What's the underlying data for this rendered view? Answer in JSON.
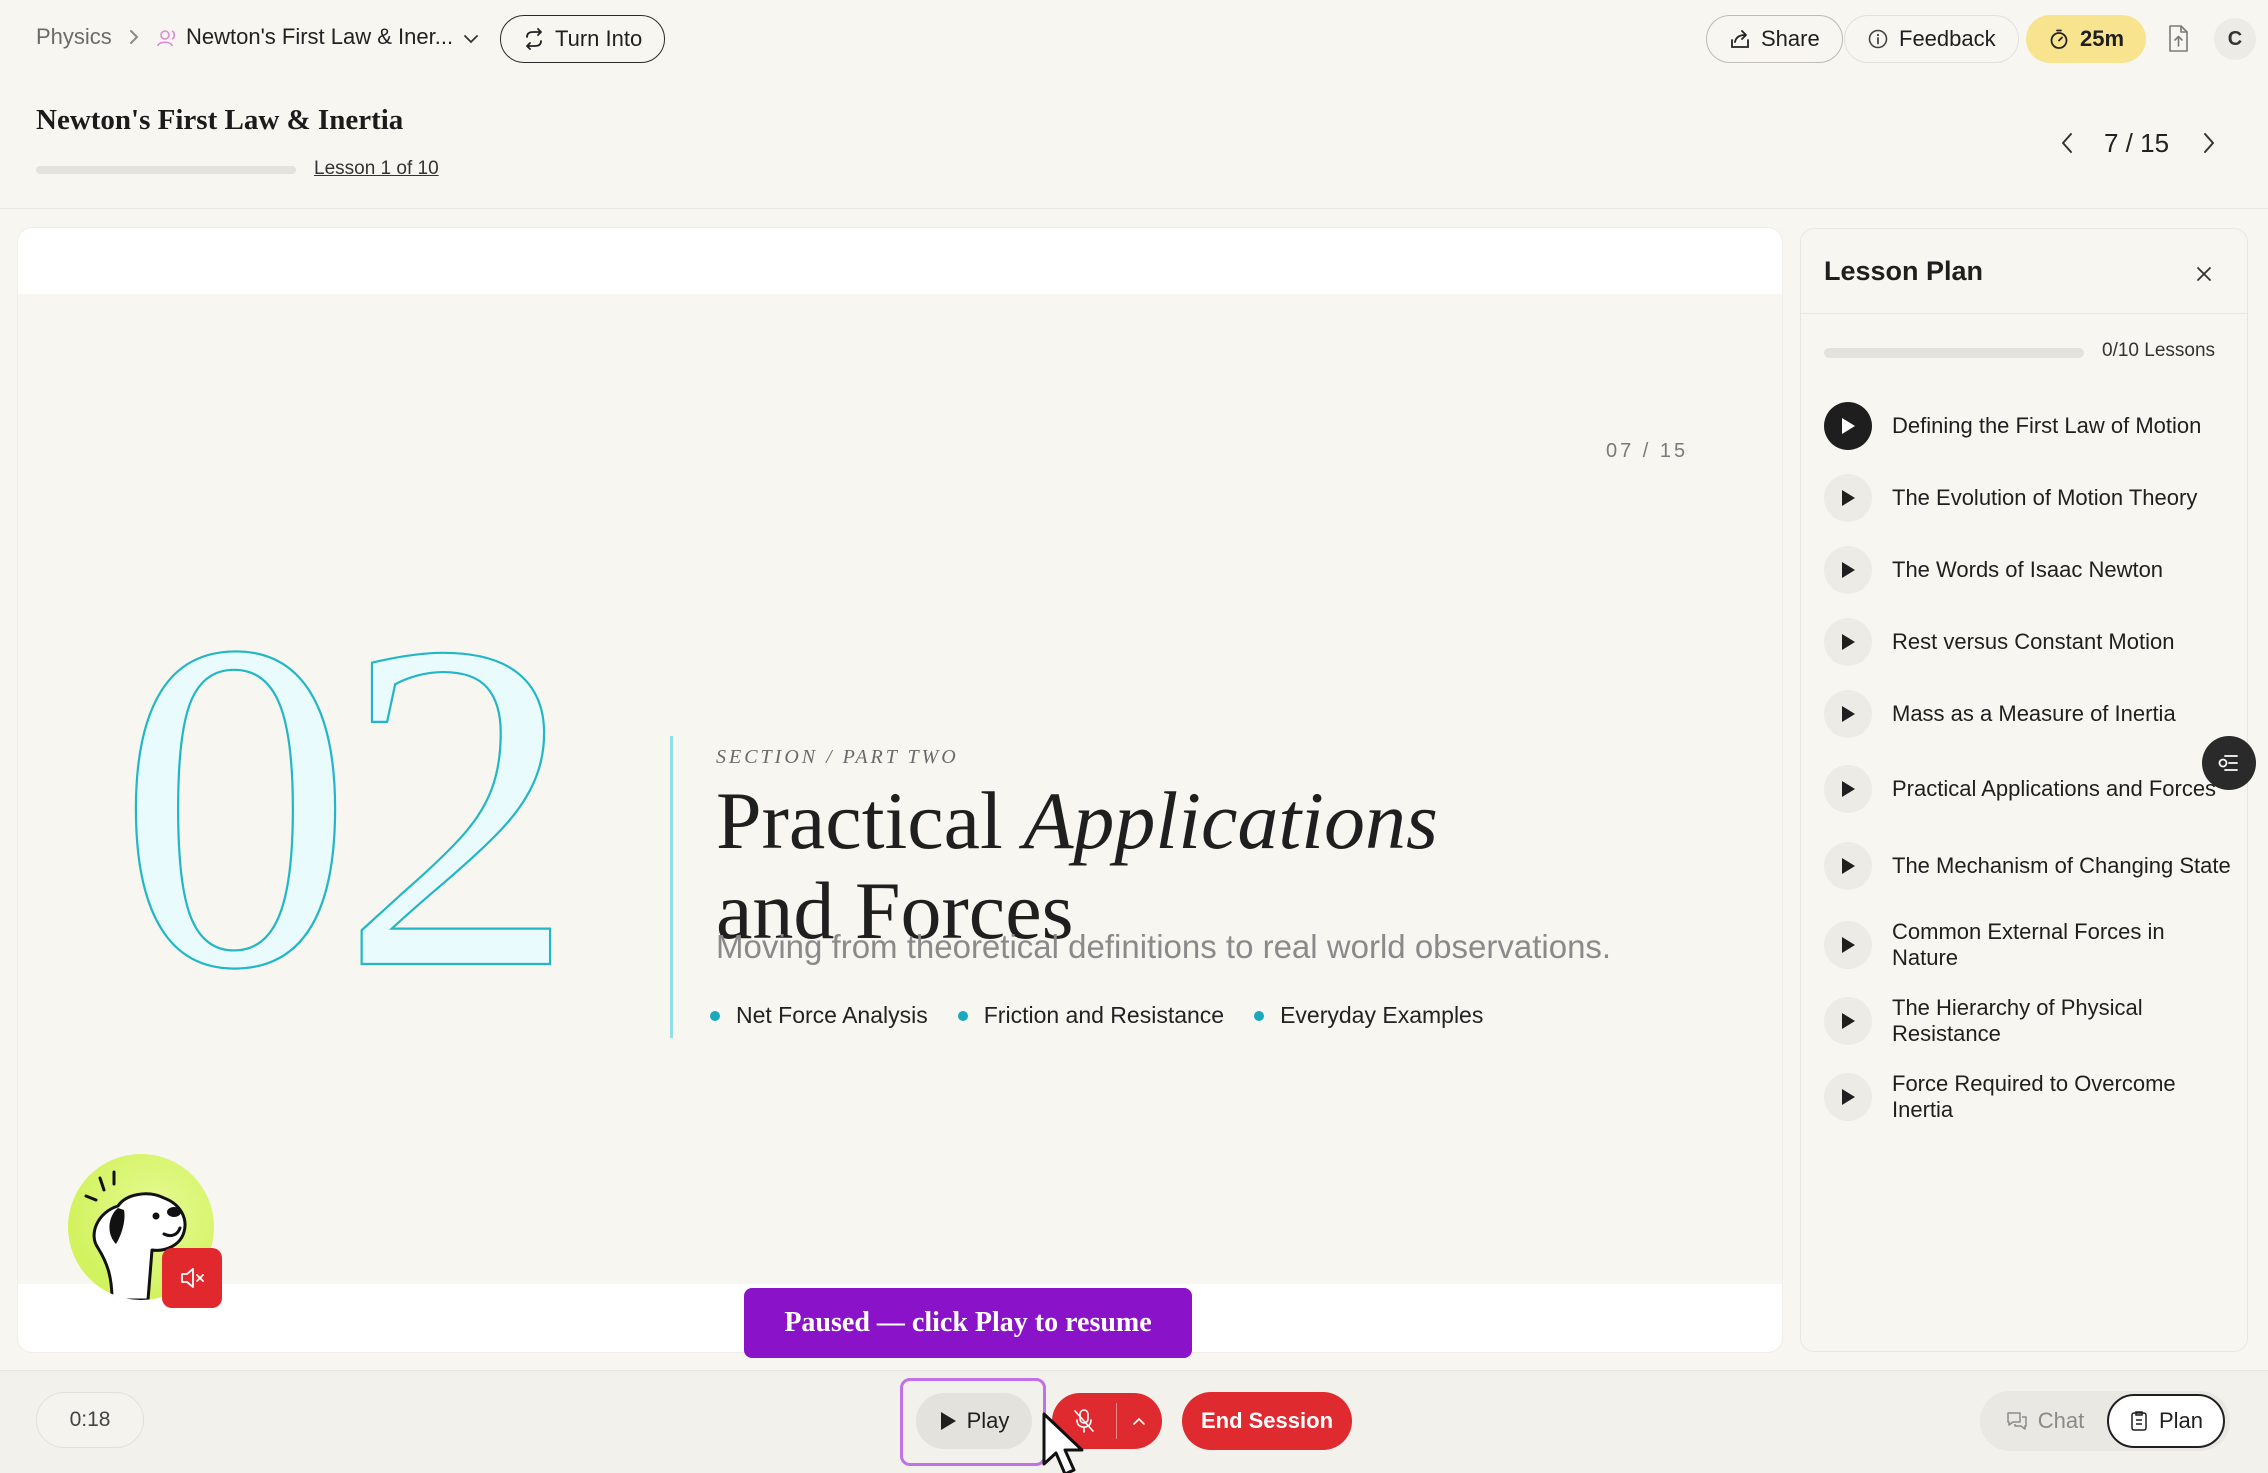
{
  "breadcrumb": {
    "root": "Physics",
    "current": "Newton's First Law & Iner..."
  },
  "toolbar": {
    "turn_into": "Turn Into",
    "share": "Share",
    "feedback": "Feedback",
    "timer": "25m",
    "avatar": "C"
  },
  "header": {
    "title": "Newton's First Law & Inertia",
    "lesson_link": "Lesson 1 of 10",
    "slide_counter": "7 / 15",
    "lesson_progress": 0
  },
  "slide": {
    "number": "07 / 15",
    "big_number": "02",
    "kicker": "SECTION / PART TWO",
    "headline_a": "Practical ",
    "headline_b": "Applications",
    "headline_c": "and Forces",
    "subtitle": "Moving from theoretical definitions to real world observations.",
    "tags": [
      "Net Force Analysis",
      "Friction and Resistance",
      "Everyday Examples"
    ],
    "accent_color": "#18a9bd"
  },
  "toast": {
    "text": "Paused — click Play to resume"
  },
  "lesson_plan": {
    "title": "Lesson Plan",
    "count": "0/10 Lessons",
    "progress": 0,
    "items": [
      "Defining the First Law of Motion",
      "The Evolution of Motion Theory",
      "The Words of Isaac Newton",
      "Rest versus Constant Motion",
      "Mass as a Measure of Inertia",
      "Practical Applications and Forces",
      "The Mechanism of Changing State",
      "Common External Forces in Nature",
      "The Hierarchy of Physical Resistance",
      "Force Required to Overcome Inertia"
    ]
  },
  "bottom_bar": {
    "elapsed": "0:18",
    "play": "Play",
    "end_session": "End Session",
    "chat": "Chat",
    "plan": "Plan",
    "end_color": "#df2a2f",
    "toast_color": "#8a12c9"
  }
}
